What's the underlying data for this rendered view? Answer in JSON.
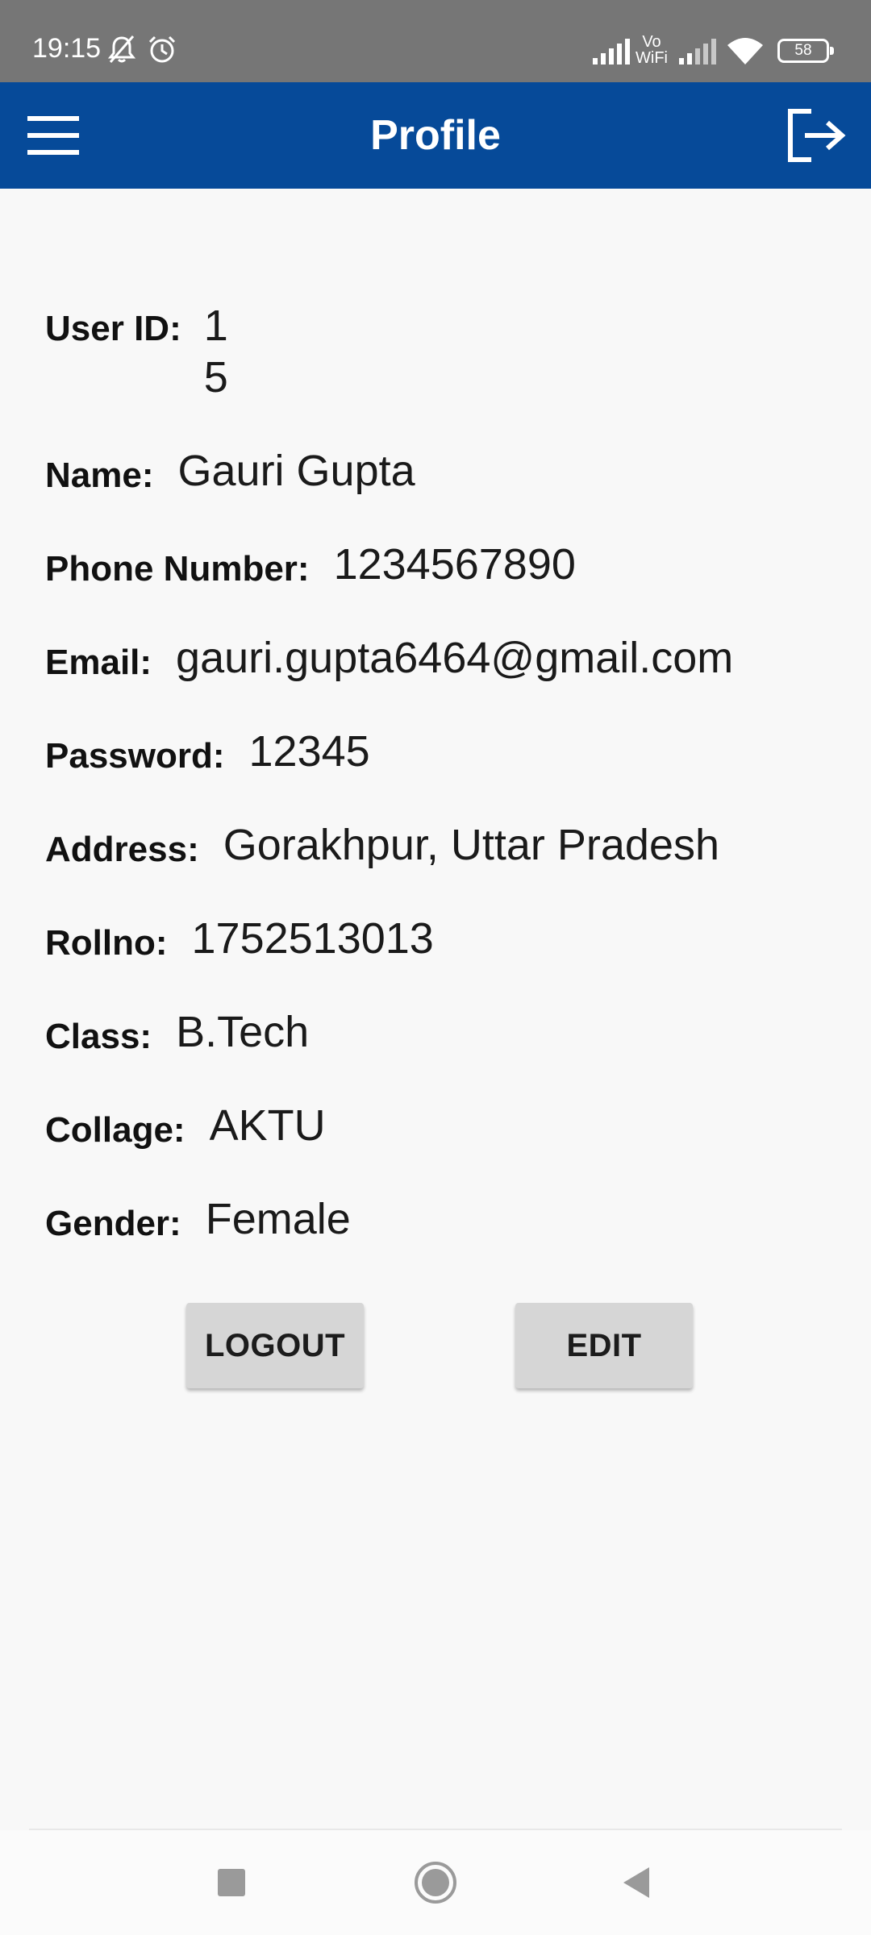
{
  "status_bar": {
    "time": "19:15",
    "icons": [
      "mute-bell-icon",
      "alarm-icon",
      "signal-icon",
      "vowifi-icon",
      "signal-icon",
      "wifi-icon",
      "battery-icon"
    ],
    "vowifi_label_top": "Vo",
    "vowifi_label_bottom": "WiFi",
    "battery": "58"
  },
  "app_bar": {
    "title": "Profile",
    "menu_icon": "hamburger-menu-icon",
    "logout_icon": "logout-icon",
    "color": "#064a99"
  },
  "profile": {
    "user_id": {
      "label": "User ID:",
      "value": "15"
    },
    "name": {
      "label": "Name:",
      "value": "Gauri Gupta"
    },
    "phone": {
      "label": "Phone Number:",
      "value": "1234567890"
    },
    "email": {
      "label": "Email:",
      "value": "gauri.gupta6464@gmail.com"
    },
    "password": {
      "label": "Password:",
      "value": "12345"
    },
    "address": {
      "label": "Address:",
      "value": "Gorakhpur, Uttar Pradesh"
    },
    "rollno": {
      "label": "Rollno:",
      "value": "1752513013"
    },
    "class": {
      "label": "Class:",
      "value": "B.Tech"
    },
    "collage": {
      "label": "Collage:",
      "value": "AKTU"
    },
    "gender": {
      "label": "Gender:",
      "value": "Female"
    }
  },
  "actions": {
    "logout_label": "LOGOUT",
    "edit_label": "EDIT"
  },
  "nav_bar": {
    "icons": [
      "recents-square-icon",
      "home-circle-icon",
      "back-triangle-icon"
    ]
  }
}
